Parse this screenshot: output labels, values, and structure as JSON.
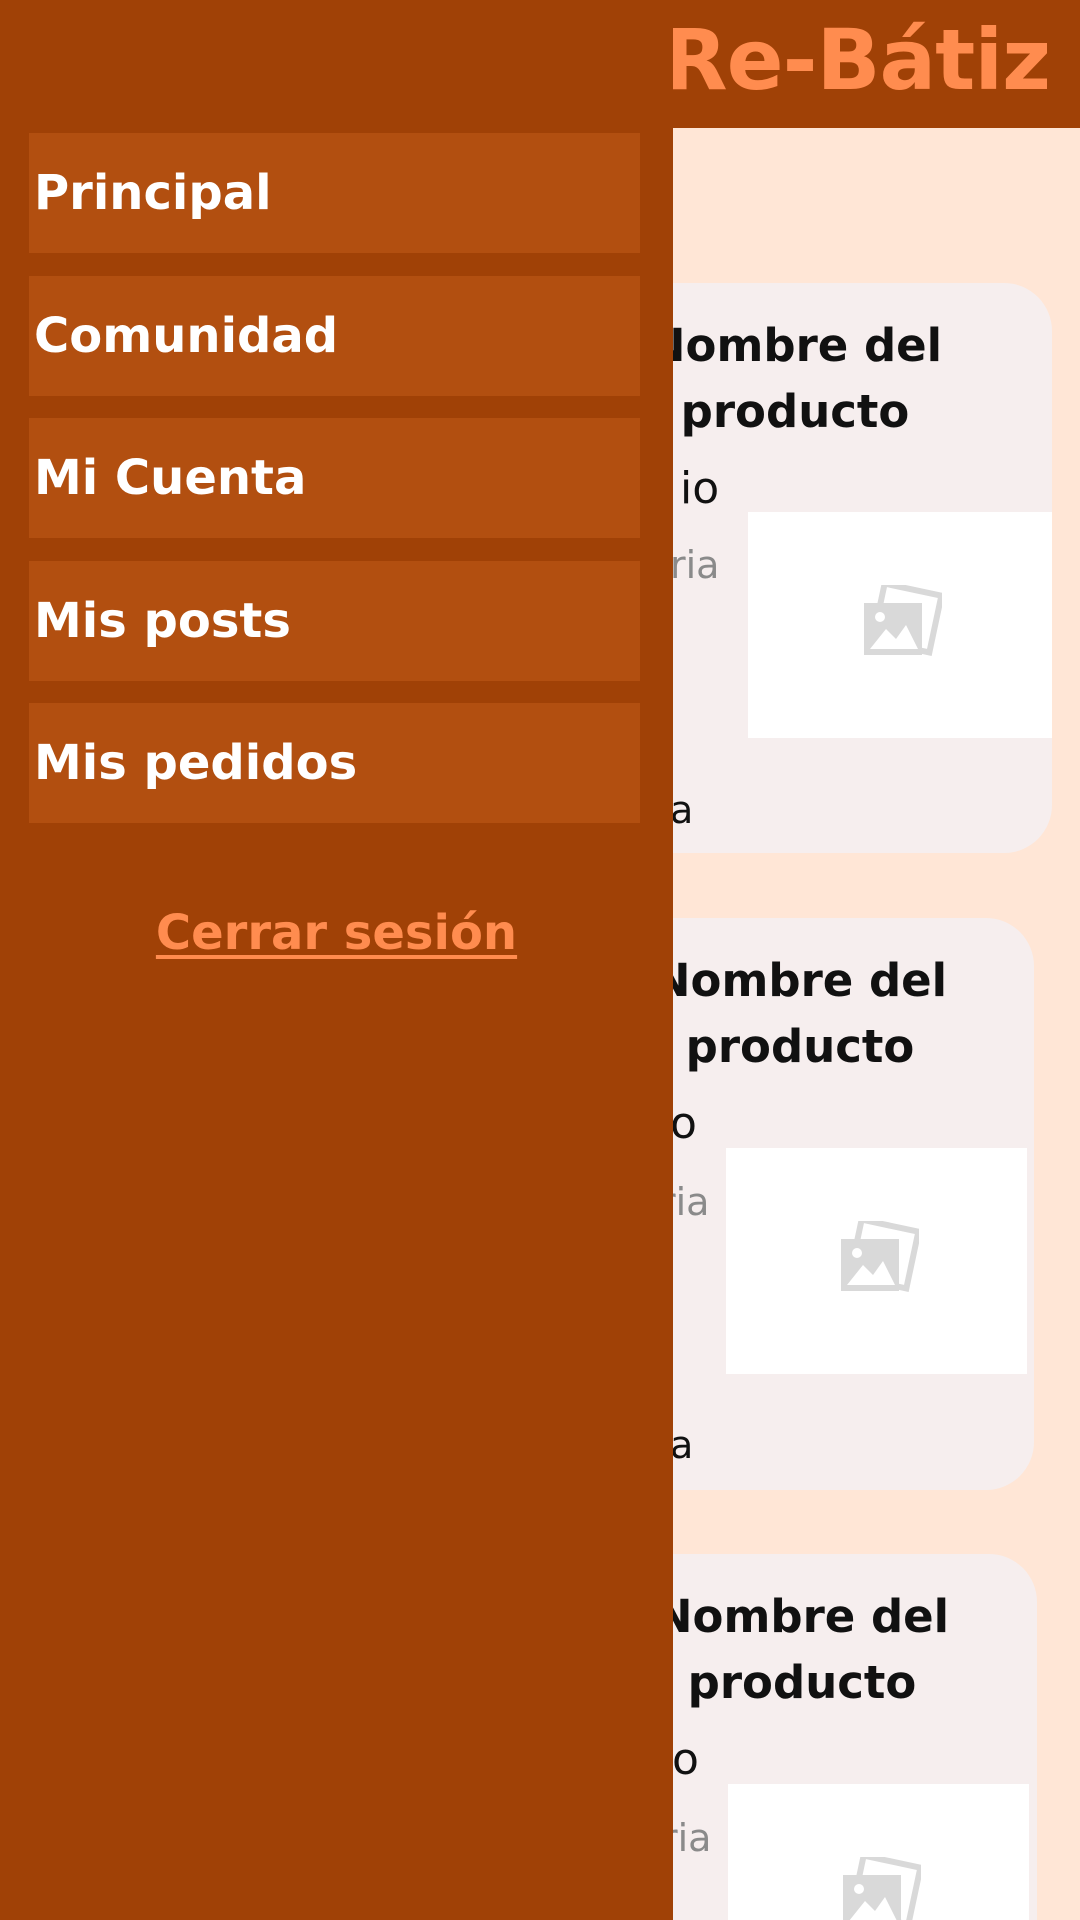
{
  "header": {
    "brand": "Re-Bátiz"
  },
  "menu": {
    "items": [
      {
        "label": "Principal"
      },
      {
        "label": "Comunidad"
      },
      {
        "label": "Mi Cuenta"
      },
      {
        "label": "Mis posts"
      },
      {
        "label": "Mis pedidos"
      }
    ],
    "logout_label": "Cerrar sesión"
  },
  "products": [
    {
      "title": "Nombre del producto",
      "price_partial": "io",
      "category_partial": "ria",
      "footer_partial": "a"
    },
    {
      "title": "Nombre del producto",
      "price_partial": "o",
      "category_partial": "ria",
      "footer_partial": "a"
    },
    {
      "title": "Nombre del producto",
      "price_partial": "o",
      "category_partial": "ria",
      "footer_partial": ""
    }
  ],
  "colors": {
    "drawer_bg": "#a04106",
    "menu_item_bg": "#b24f10",
    "brand_accent": "#ff8c4f",
    "page_bg": "#ffe6d6",
    "card_bg": "#f6eeee"
  },
  "icons": {
    "product_image": "image-placeholder-icon"
  }
}
